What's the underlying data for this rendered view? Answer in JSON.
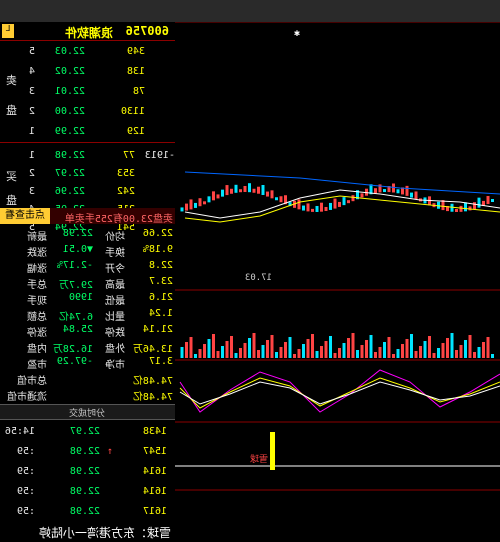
{
  "header": {
    "code": "600756",
    "name": "浪潮软件",
    "flag": "L"
  },
  "order_book": {
    "sell_label_1": "卖",
    "sell_label_2": "盘",
    "buy_label_1": "买",
    "buy_label_2": "盘",
    "sells": [
      {
        "level": "5",
        "price": "22.03",
        "vol": "349"
      },
      {
        "level": "4",
        "price": "22.02",
        "vol": "138"
      },
      {
        "level": "3",
        "price": "22.01",
        "vol": "78"
      },
      {
        "level": "2",
        "price": "22.00",
        "vol": "1130"
      },
      {
        "level": "1",
        "price": "22.99",
        "vol": "129"
      }
    ],
    "buys": [
      {
        "level": "1",
        "price": "22.98",
        "vol": "77",
        "extra": "-1913"
      },
      {
        "level": "2",
        "price": "22.97",
        "vol": "353"
      },
      {
        "level": "3",
        "price": "22.96",
        "vol": "242"
      },
      {
        "level": "4",
        "price": "22.95",
        "vol": "215"
      },
      {
        "level": "5",
        "price": "22.94",
        "vol": "541"
      }
    ]
  },
  "banner": {
    "text": "卖盘23.00有255手卖单",
    "button": "点击查看"
  },
  "stats": [
    {
      "l1": "最新",
      "v1": "22.98",
      "l2": "均价",
      "v2": "22.66"
    },
    {
      "l1": "涨跌",
      "v1": "▼0.51",
      "l2": "换手",
      "v2": "9.18%"
    },
    {
      "l1": "涨幅",
      "v1": "-2.17%",
      "l2": "今开",
      "v2": "22.8"
    },
    {
      "l1": "总手",
      "v1": "29.7万",
      "l2": "最高",
      "v2": "23.7"
    },
    {
      "l1": "现手",
      "v1": "1990",
      "l2": "最低",
      "v2": "21.6"
    },
    {
      "l1": "总额",
      "v1": "6.74亿",
      "l2": "量比",
      "v2": "1.24"
    },
    {
      "l1": "涨停",
      "v1": "25.84",
      "l2": "跌停",
      "v2": "21.14"
    },
    {
      "l1": "内盘",
      "v1": "16.28万",
      "l2": "外盘",
      "v2": "13.46万"
    },
    {
      "l1": "市盈",
      "v1": "-97.29",
      "l2": "市净",
      "v2": "3.17"
    },
    {
      "l1": "总市值",
      "v1": "",
      "l2": "",
      "v2": "74.48亿"
    },
    {
      "l1": "流通市值",
      "v1": "",
      "l2": "",
      "v2": "74.48亿"
    }
  ],
  "tab": {
    "label": "分时成交"
  },
  "ticks": [
    {
      "time": "14:56",
      "price": "22.97",
      "vol": "1438"
    },
    {
      "time": ":59",
      "price": "22.98",
      "vol": "1547",
      "arrow": "↑"
    },
    {
      "time": ":59",
      "price": "22.98",
      "vol": "1614"
    },
    {
      "time": ":59",
      "price": "22.98",
      "vol": "1614"
    },
    {
      "time": ":59",
      "price": "22.98",
      "vol": "1617"
    }
  ],
  "watermark": {
    "text": "雪球：东方港湾一小陆婷"
  },
  "chart": {
    "low_label": "17.03",
    "red_label": "雪球"
  },
  "colors": {
    "up": "#ff4444",
    "down": "#00ff66",
    "accent": "#ffff00",
    "grid": "#8b0000"
  }
}
